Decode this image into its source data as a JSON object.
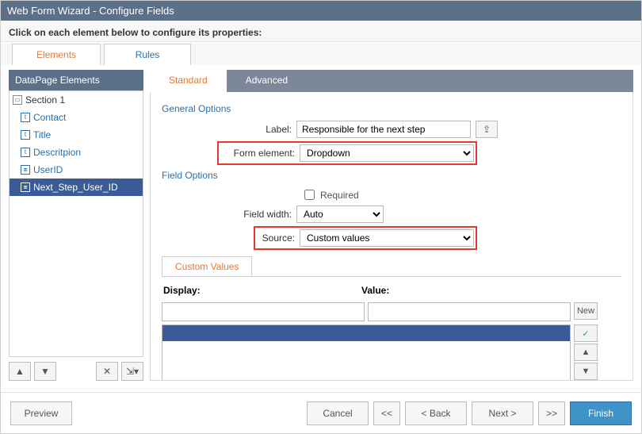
{
  "window": {
    "title": "Web Form Wizard - Configure Fields"
  },
  "instruction": "Click on each element below to configure its properties:",
  "top_tabs": {
    "elements": "Elements",
    "rules": "Rules"
  },
  "sidebar": {
    "header": "DataPage Elements",
    "items": [
      {
        "label": "Section 1",
        "type": "section"
      },
      {
        "label": "Contact",
        "type": "text"
      },
      {
        "label": "Title",
        "type": "text"
      },
      {
        "label": "Descritpion",
        "type": "text"
      },
      {
        "label": "UserID",
        "type": "data"
      },
      {
        "label": "Next_Step_User_ID",
        "type": "data",
        "selected": true
      }
    ]
  },
  "sub_tabs": {
    "standard": "Standard",
    "advanced": "Advanced"
  },
  "general": {
    "section_label": "General Options",
    "label_label": "Label:",
    "label_value": "Responsible for the next step",
    "form_element_label": "Form element:",
    "form_element_value": "Dropdown"
  },
  "field_options": {
    "section_label": "Field Options",
    "required_label": "Required",
    "width_label": "Field width:",
    "width_value": "Auto",
    "source_label": "Source:",
    "source_value": "Custom values"
  },
  "custom_values": {
    "tab_label": "Custom Values",
    "display_header": "Display:",
    "value_header": "Value:",
    "new_btn": "New"
  },
  "footer": {
    "preview": "Preview",
    "cancel": "Cancel",
    "prev_group": "<<",
    "back": "< Back",
    "next": "Next >",
    "next_group": ">>",
    "finish": "Finish"
  }
}
